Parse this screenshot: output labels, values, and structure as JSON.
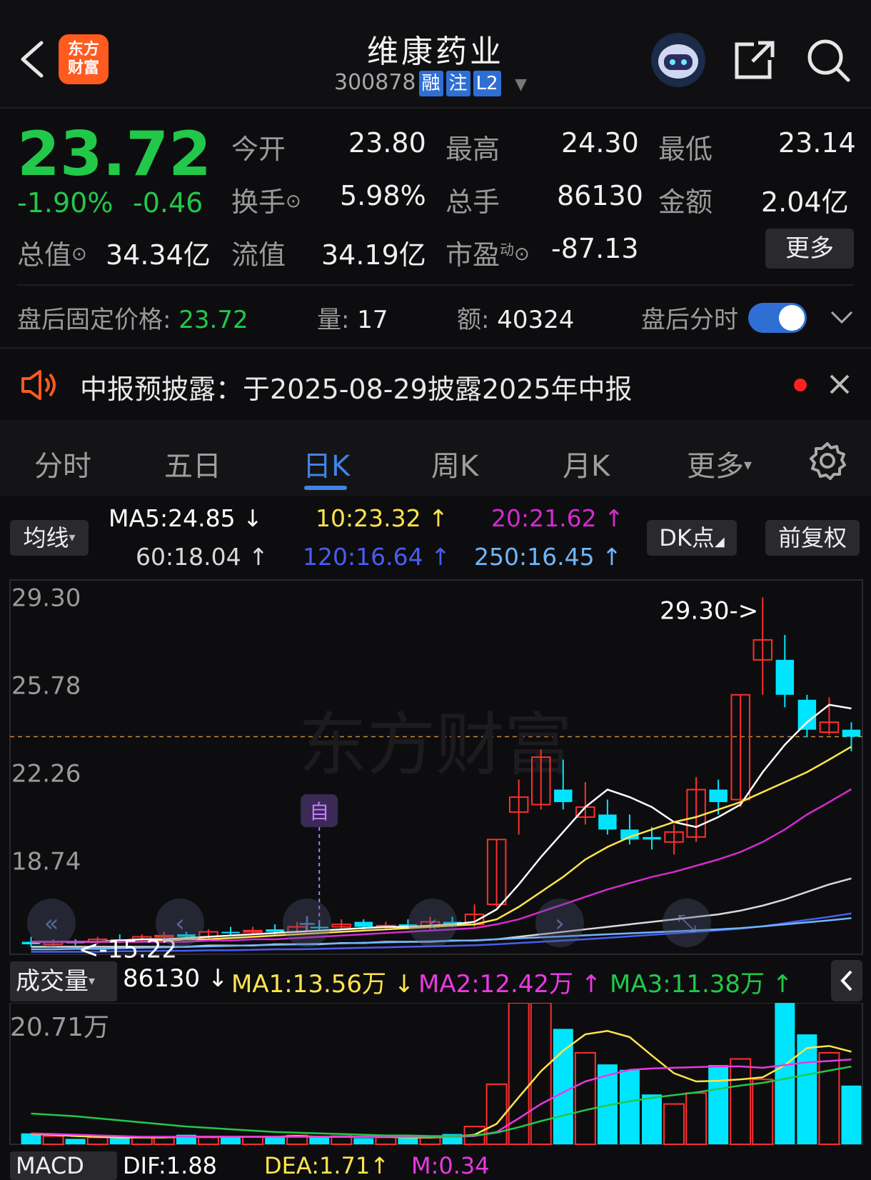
{
  "header": {
    "back_icon": "chevron-left-icon",
    "logo_text": "东方\n财富",
    "title": "维康药业",
    "code": "300878",
    "tags": [
      "融",
      "注",
      "L2"
    ],
    "share_icon": "share-icon",
    "search_icon": "search-icon"
  },
  "quote": {
    "price": "23.72",
    "change_pct": "-1.90%",
    "change": "-0.46",
    "open_label": "今开",
    "open": "23.80",
    "high_label": "最高",
    "high": "24.30",
    "low_label": "最低",
    "low": "23.14",
    "turnover_label": "换手",
    "turnover": "5.98%",
    "volume_label": "总手",
    "volume": "86130",
    "amount_label": "金额",
    "amount": "2.04亿",
    "mktcap_label": "总值",
    "mktcap": "34.34亿",
    "float_label": "流值",
    "float": "34.19亿",
    "pe_label": "市盈",
    "pe_sup": "动",
    "pe": "-87.13",
    "more_label": "更多"
  },
  "afterhours": {
    "price_label": "盘后固定价格:",
    "price": "23.72",
    "vol_label": "量:",
    "vol": "17",
    "amt_label": "额:",
    "amt": "40324",
    "toggle_label": "盘后分时",
    "toggle_on": true
  },
  "notice": {
    "text": "中报预披露：于2025-08-29披露2025年中报"
  },
  "tabs": [
    "分时",
    "五日",
    "日K",
    "周K",
    "月K",
    "更多"
  ],
  "active_tab": "日K",
  "ma_bar": {
    "select_label": "均线",
    "ma5": "MA5:24.85",
    "ma5_arrow": "↓",
    "ma10": "10:23.32",
    "ma10_arrow": "↑",
    "ma20": "20:21.62",
    "ma20_arrow": "↑",
    "ma60": "60:18.04",
    "ma60_arrow": "↑",
    "ma120": "120:16.64",
    "ma120_arrow": "↑",
    "ma250": "250:16.45",
    "ma250_arrow": "↑",
    "dk_label": "DK点",
    "adjust_label": "前复权"
  },
  "colors": {
    "up": "#ff2e2e",
    "down": "#00e5ff",
    "ma5": "#ffffff",
    "ma10": "#ffe44d",
    "ma20": "#d42bd0",
    "ma60": "#d9d9d9",
    "ma120": "#4a5cf0",
    "ma250": "#6fb7ff"
  },
  "chart_data": [
    {
      "type": "candlestick",
      "y_ticks": [
        "29.30",
        "25.78",
        "22.26",
        "18.74"
      ],
      "max_label": "29.30->",
      "min_label": "<-15.22",
      "marker_label": "自",
      "last_close": 23.72,
      "ylim": [
        15.0,
        30.0
      ],
      "candles": [
        {
          "o": 15.5,
          "c": 15.4,
          "h": 15.7,
          "l": 15.3
        },
        {
          "o": 15.4,
          "c": 15.5,
          "h": 15.6,
          "l": 15.3
        },
        {
          "o": 15.5,
          "c": 15.45,
          "h": 15.6,
          "l": 15.35
        },
        {
          "o": 15.5,
          "c": 15.6,
          "h": 15.7,
          "l": 15.4
        },
        {
          "o": 15.6,
          "c": 15.55,
          "h": 15.8,
          "l": 15.45
        },
        {
          "o": 15.6,
          "c": 15.7,
          "h": 15.8,
          "l": 15.5
        },
        {
          "o": 15.7,
          "c": 15.75,
          "h": 15.9,
          "l": 15.6
        },
        {
          "o": 15.8,
          "c": 15.7,
          "h": 15.9,
          "l": 15.6
        },
        {
          "o": 15.7,
          "c": 15.9,
          "h": 16.0,
          "l": 15.6
        },
        {
          "o": 15.9,
          "c": 15.85,
          "h": 16.1,
          "l": 15.75
        },
        {
          "o": 15.9,
          "c": 15.95,
          "h": 16.1,
          "l": 15.8
        },
        {
          "o": 16.0,
          "c": 15.9,
          "h": 16.2,
          "l": 15.8
        },
        {
          "o": 15.9,
          "c": 16.1,
          "h": 16.3,
          "l": 15.85
        },
        {
          "o": 16.1,
          "c": 16.05,
          "h": 16.3,
          "l": 15.95
        },
        {
          "o": 16.1,
          "c": 16.2,
          "h": 16.4,
          "l": 16.0
        },
        {
          "o": 16.3,
          "c": 16.1,
          "h": 16.4,
          "l": 16.0
        },
        {
          "o": 16.1,
          "c": 16.15,
          "h": 16.3,
          "l": 16.0
        },
        {
          "o": 16.2,
          "c": 16.1,
          "h": 16.4,
          "l": 16.0
        },
        {
          "o": 16.1,
          "c": 16.3,
          "h": 16.5,
          "l": 16.0
        },
        {
          "o": 16.3,
          "c": 16.2,
          "h": 16.5,
          "l": 16.1
        },
        {
          "o": 16.2,
          "c": 16.6,
          "h": 17.0,
          "l": 16.1
        },
        {
          "o": 17.0,
          "c": 19.6,
          "h": 19.6,
          "l": 16.9
        },
        {
          "o": 20.7,
          "c": 21.3,
          "h": 22.0,
          "l": 19.8
        },
        {
          "o": 21.0,
          "c": 22.9,
          "h": 23.2,
          "l": 20.8
        },
        {
          "o": 21.6,
          "c": 21.1,
          "h": 22.8,
          "l": 20.8
        },
        {
          "o": 20.5,
          "c": 20.9,
          "h": 21.9,
          "l": 20.2
        },
        {
          "o": 20.6,
          "c": 20.0,
          "h": 21.2,
          "l": 19.8
        },
        {
          "o": 20.0,
          "c": 19.6,
          "h": 20.6,
          "l": 19.4
        },
        {
          "o": 19.7,
          "c": 19.6,
          "h": 20.1,
          "l": 19.2
        },
        {
          "o": 19.5,
          "c": 19.9,
          "h": 20.2,
          "l": 19.0
        },
        {
          "o": 19.7,
          "c": 21.6,
          "h": 22.1,
          "l": 19.5
        },
        {
          "o": 21.6,
          "c": 21.1,
          "h": 22.0,
          "l": 20.6
        },
        {
          "o": 21.2,
          "c": 25.4,
          "h": 25.4,
          "l": 20.9
        },
        {
          "o": 26.8,
          "c": 27.6,
          "h": 29.3,
          "l": 25.4
        },
        {
          "o": 26.8,
          "c": 25.4,
          "h": 27.8,
          "l": 24.9
        },
        {
          "o": 25.2,
          "c": 24.0,
          "h": 25.4,
          "l": 23.7
        },
        {
          "o": 23.9,
          "c": 24.3,
          "h": 25.3,
          "l": 23.8
        },
        {
          "o": 24.0,
          "c": 23.72,
          "h": 24.3,
          "l": 23.14
        }
      ],
      "ma_lines": {
        "ma5": [
          15.5,
          15.5,
          15.5,
          15.5,
          15.55,
          15.6,
          15.6,
          15.65,
          15.7,
          15.75,
          15.8,
          15.85,
          15.9,
          15.95,
          16.0,
          16.05,
          16.1,
          16.1,
          16.15,
          16.2,
          16.3,
          16.8,
          17.8,
          18.9,
          19.9,
          20.9,
          21.6,
          21.3,
          20.9,
          20.3,
          20.1,
          20.5,
          21.0,
          22.3,
          23.4,
          24.3,
          25.0,
          24.85
        ],
        "ma10": [
          15.5,
          15.5,
          15.5,
          15.5,
          15.5,
          15.5,
          15.55,
          15.6,
          15.6,
          15.65,
          15.7,
          15.75,
          15.8,
          15.85,
          15.9,
          15.95,
          16.0,
          16.05,
          16.1,
          16.15,
          16.2,
          16.4,
          16.9,
          17.5,
          18.1,
          18.8,
          19.3,
          19.7,
          20.0,
          20.3,
          20.5,
          20.8,
          21.1,
          21.5,
          21.9,
          22.3,
          22.8,
          23.32
        ],
        "ma20": [
          15.5,
          15.5,
          15.5,
          15.5,
          15.5,
          15.5,
          15.5,
          15.5,
          15.55,
          15.55,
          15.6,
          15.6,
          15.65,
          15.7,
          15.75,
          15.8,
          15.85,
          15.9,
          15.95,
          16.0,
          16.05,
          16.2,
          16.4,
          16.7,
          17.0,
          17.3,
          17.6,
          17.85,
          18.1,
          18.3,
          18.55,
          18.8,
          19.1,
          19.5,
          20.0,
          20.6,
          21.1,
          21.62
        ],
        "ma60": [
          15.3,
          15.3,
          15.3,
          15.3,
          15.3,
          15.3,
          15.3,
          15.3,
          15.35,
          15.35,
          15.35,
          15.4,
          15.4,
          15.4,
          15.45,
          15.45,
          15.5,
          15.5,
          15.5,
          15.55,
          15.55,
          15.6,
          15.7,
          15.8,
          15.9,
          16.0,
          16.1,
          16.2,
          16.3,
          16.4,
          16.5,
          16.6,
          16.75,
          16.95,
          17.2,
          17.5,
          17.8,
          18.04
        ],
        "ma120": [
          15.1,
          15.1,
          15.1,
          15.1,
          15.12,
          15.12,
          15.14,
          15.14,
          15.16,
          15.16,
          15.18,
          15.2,
          15.2,
          15.22,
          15.24,
          15.26,
          15.28,
          15.3,
          15.32,
          15.34,
          15.36,
          15.4,
          15.45,
          15.5,
          15.55,
          15.6,
          15.66,
          15.72,
          15.78,
          15.84,
          15.9,
          15.96,
          16.03,
          16.12,
          16.25,
          16.38,
          16.5,
          16.64
        ],
        "ma250": [
          15.2,
          15.2,
          15.22,
          15.22,
          15.24,
          15.26,
          15.28,
          15.3,
          15.32,
          15.34,
          15.36,
          15.38,
          15.4,
          15.42,
          15.44,
          15.46,
          15.48,
          15.5,
          15.52,
          15.54,
          15.56,
          15.6,
          15.64,
          15.68,
          15.72,
          15.76,
          15.8,
          15.84,
          15.88,
          15.92,
          15.96,
          16.0,
          16.05,
          16.12,
          16.2,
          16.28,
          16.36,
          16.45
        ]
      }
    },
    {
      "type": "bar",
      "title_label": "成交量",
      "value": "86130",
      "value_arrow": "↓",
      "ma1": "MA1:13.56万",
      "ma1_arrow": "↓",
      "ma2": "MA2:12.42万",
      "ma2_arrow": "↑",
      "ma3": "MA3:11.38万",
      "ma3_arrow": "↑",
      "y_tick": "20.71万",
      "ylim": [
        0,
        20.71
      ],
      "volumes": [
        1.6,
        1.2,
        0.8,
        1.0,
        0.9,
        1.1,
        1.0,
        1.4,
        1.0,
        1.2,
        1.1,
        1.0,
        1.3,
        1.0,
        1.2,
        0.9,
        1.0,
        1.1,
        1.0,
        1.5,
        2.6,
        8.8,
        20.7,
        20.71,
        16.9,
        13.4,
        11.7,
        10.9,
        7.3,
        5.9,
        7.5,
        11.6,
        12.5,
        9.5,
        20.7,
        16.1,
        13.4,
        8.6
      ],
      "ma_lines": {
        "ma1": [
          1.5,
          1.4,
          1.2,
          1.1,
          1.0,
          1.0,
          1.0,
          1.1,
          1.1,
          1.1,
          1.1,
          1.1,
          1.2,
          1.1,
          1.1,
          1.1,
          1.1,
          1.0,
          1.0,
          1.1,
          1.4,
          3.0,
          6.9,
          10.7,
          13.7,
          16.1,
          16.6,
          15.7,
          13.0,
          10.4,
          9.2,
          9.3,
          9.5,
          9.8,
          11.6,
          14.1,
          14.4,
          13.56
        ],
        "ma2": [
          1.6,
          1.5,
          1.4,
          1.3,
          1.2,
          1.1,
          1.1,
          1.1,
          1.1,
          1.1,
          1.1,
          1.1,
          1.1,
          1.1,
          1.1,
          1.1,
          1.1,
          1.1,
          1.1,
          1.1,
          1.2,
          1.8,
          3.8,
          5.9,
          7.6,
          9.2,
          10.1,
          10.9,
          11.1,
          11.2,
          11.3,
          11.4,
          11.4,
          11.2,
          11.6,
          12.0,
          12.2,
          12.42
        ],
        "ma3": [
          4.5,
          4.3,
          4.1,
          3.8,
          3.5,
          3.2,
          2.9,
          2.6,
          2.4,
          2.2,
          2.0,
          1.8,
          1.7,
          1.6,
          1.5,
          1.4,
          1.3,
          1.3,
          1.2,
          1.2,
          1.3,
          1.7,
          2.5,
          3.4,
          4.2,
          5.0,
          5.7,
          6.3,
          6.8,
          7.2,
          7.6,
          8.1,
          8.6,
          9.0,
          9.6,
          10.2,
          10.8,
          11.38
        ]
      }
    }
  ],
  "macd_bar": {
    "label": "MACD",
    "dif": "DIF:1.88",
    "dea": "DEA:1.71",
    "dea_arrow": "↑",
    "m": "M:0.34"
  }
}
